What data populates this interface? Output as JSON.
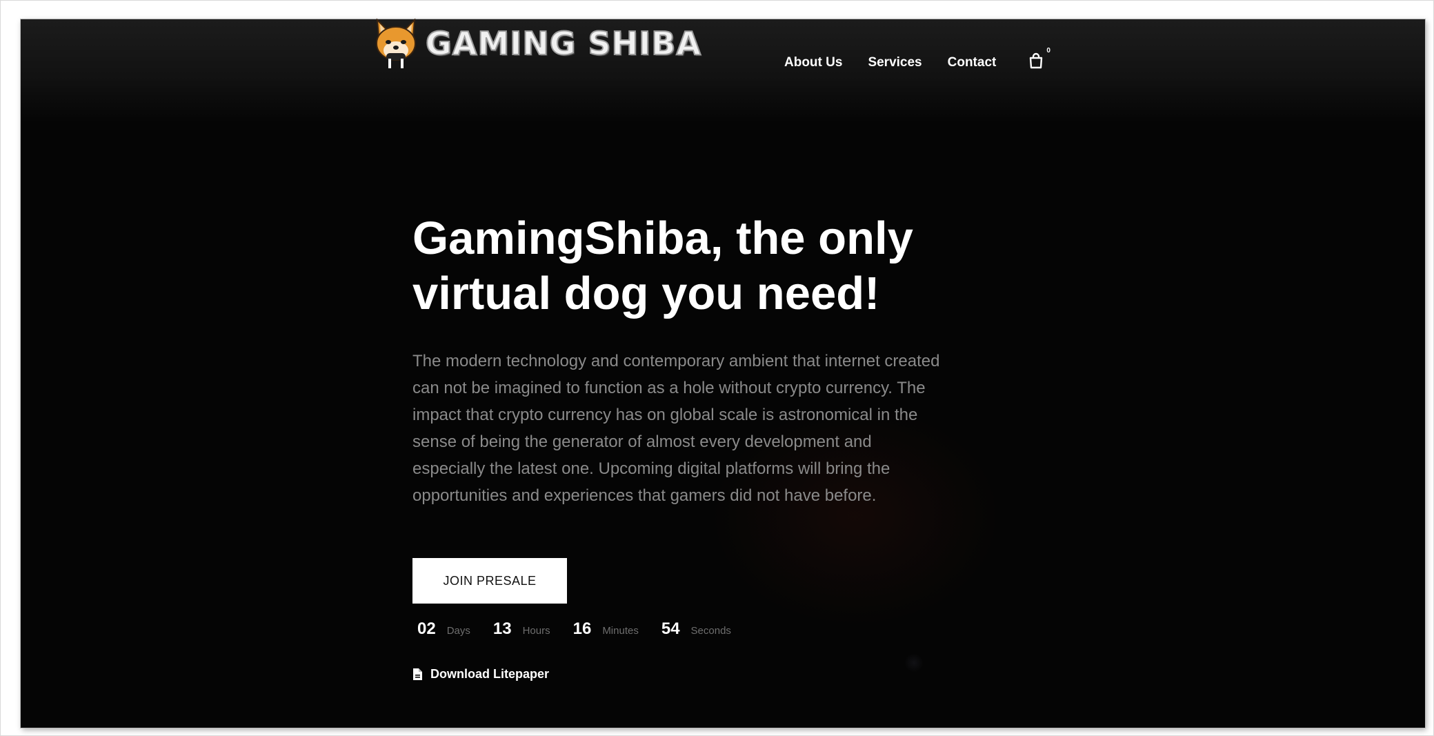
{
  "brand": {
    "name": "GAMING SHIBA",
    "logo_icon": "shiba-dog-mascot-icon"
  },
  "nav": {
    "items": [
      {
        "label": "About Us"
      },
      {
        "label": "Services"
      },
      {
        "label": "Contact"
      }
    ],
    "cart_icon": "shopping-bag-icon",
    "cart_count": "0"
  },
  "hero": {
    "title_line1": "GamingShiba, the only",
    "title_line2": "virtual dog you need!",
    "description": "The modern technology and contemporary ambient that internet created can not be imagined to function as a hole without crypto currency. The impact that crypto currency has on global scale is astronomical in the sense of being the generator of almost every development and especially the latest one. Upcoming digital platforms will bring the opportunities and experiences that gamers did not have before.",
    "cta_label": "JOIN PRESALE"
  },
  "countdown": {
    "days": {
      "value": "02",
      "label": "Days"
    },
    "hours": {
      "value": "13",
      "label": "Hours"
    },
    "minutes": {
      "value": "16",
      "label": "Minutes"
    },
    "seconds": {
      "value": "54",
      "label": "Seconds"
    }
  },
  "download": {
    "icon": "file-icon",
    "label": "Download Litepaper"
  },
  "colors": {
    "background": "#050505",
    "text_primary": "#ffffff",
    "text_muted": "#8a8a8a",
    "button_bg": "#ffffff",
    "logo_orange": "#e8982e"
  }
}
